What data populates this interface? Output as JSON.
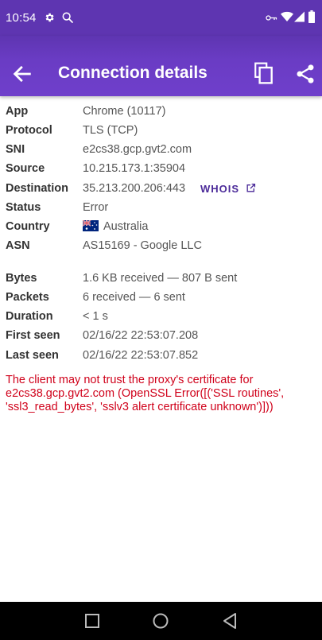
{
  "status_bar": {
    "time": "10:54"
  },
  "app_bar": {
    "title": "Connection details"
  },
  "details": [
    {
      "label": "App",
      "value": "Chrome (10117)"
    },
    {
      "label": "Protocol",
      "value": "TLS (TCP)"
    },
    {
      "label": "SNI",
      "value": "e2cs38.gcp.gvt2.com"
    },
    {
      "label": "Source",
      "value": "10.215.173.1:35904"
    },
    {
      "label": "Destination",
      "value": "35.213.200.206:443"
    },
    {
      "label": "Status",
      "value": "Error"
    },
    {
      "label": "Country",
      "value": "Australia"
    },
    {
      "label": "ASN",
      "value": "AS15169 - Google LLC"
    }
  ],
  "whois_label": "WHOIS",
  "stats": [
    {
      "label": "Bytes",
      "value": "1.6 KB received — 807 B sent"
    },
    {
      "label": "Packets",
      "value": "6 received — 6 sent"
    },
    {
      "label": "Duration",
      "value": "< 1 s"
    },
    {
      "label": "First seen",
      "value": "02/16/22 22:53:07.208"
    },
    {
      "label": "Last seen",
      "value": "02/16/22 22:53:07.852"
    }
  ],
  "error_message": "The client may not trust the proxy's certificate for e2cs38.gcp.gvt2.com (OpenSSL Error([('SSL routines', 'ssl3_read_bytes', 'sslv3 alert certificate unknown')]))",
  "colors": {
    "primary": "#6f3fcb",
    "error": "#d0021b",
    "whois": "#4b2a99"
  }
}
